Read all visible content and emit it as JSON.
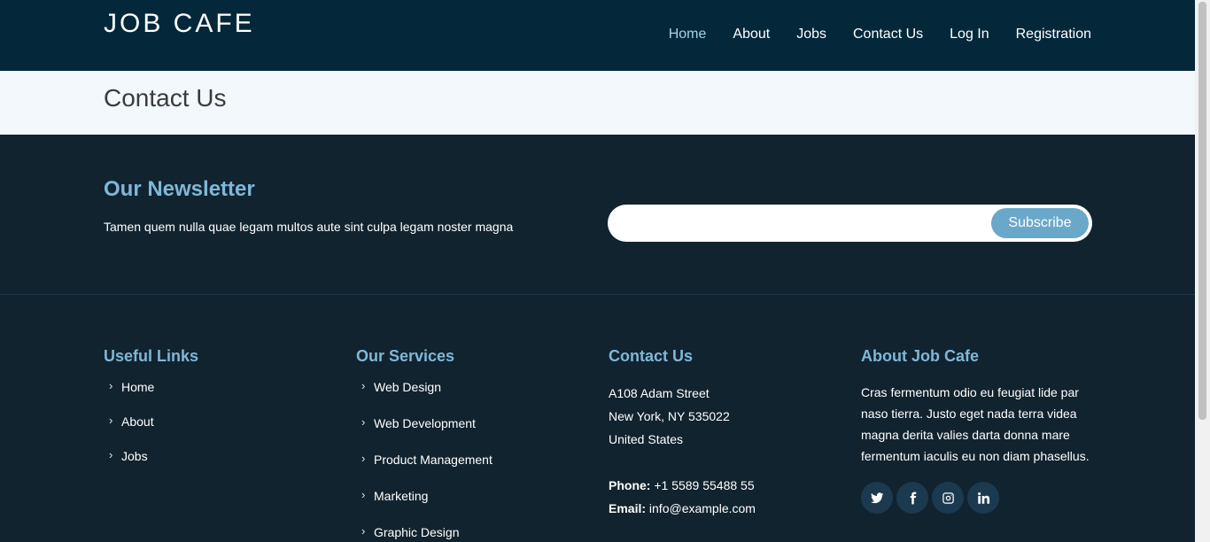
{
  "brand": {
    "logo": "JOB CAFE"
  },
  "nav": [
    {
      "label": "Home",
      "active": true
    },
    {
      "label": "About"
    },
    {
      "label": "Jobs"
    },
    {
      "label": "Contact Us"
    },
    {
      "label": "Log In"
    },
    {
      "label": "Registration"
    }
  ],
  "page_title": "Contact Us",
  "newsletter": {
    "title": "Our Newsletter",
    "text": "Tamen quem nulla quae legam multos aute sint culpa legam noster magna",
    "input_value": "",
    "button": "Subscribe"
  },
  "footer": {
    "useful_links": {
      "title": "Useful Links",
      "items": [
        "Home",
        "About",
        "Jobs"
      ]
    },
    "services": {
      "title": "Our Services",
      "items": [
        "Web Design",
        "Web Development",
        "Product Management",
        "Marketing",
        "Graphic Design"
      ]
    },
    "contact": {
      "title": "Contact Us",
      "address_lines": [
        "A108 Adam Street",
        "New York, NY 535022",
        "United States"
      ],
      "phone_label": "Phone:",
      "phone": "+1 5589 55488 55",
      "email_label": "Email:",
      "email": "info@example.com"
    },
    "about": {
      "title": "About Job Cafe",
      "text": "Cras fermentum odio eu feugiat lide par naso tierra. Justo eget nada terra videa magna derita valies darta donna mare fermentum iaculis eu non diam phasellus.",
      "social": [
        "twitter-icon",
        "facebook-icon",
        "instagram-icon",
        "linkedin-icon"
      ]
    }
  },
  "colors": {
    "header_bg": "#04283a",
    "footer_bg": "#11232f",
    "accent": "#7fb7d8",
    "button": "#6aa8c9",
    "nav_active": "#9ed3ef"
  }
}
